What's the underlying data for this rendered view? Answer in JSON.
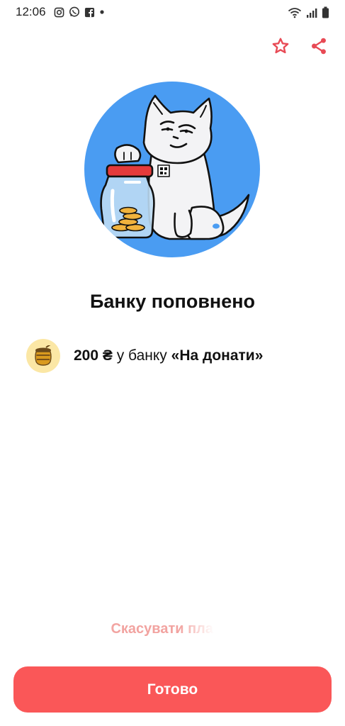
{
  "status_bar": {
    "time": "12:06",
    "left_icons": [
      "instagram-icon",
      "whatsapp-icon",
      "facebook-icon",
      "dot-icon"
    ],
    "right_icons": [
      "wifi-icon",
      "signal-icon",
      "battery-icon"
    ]
  },
  "header": {
    "actions": [
      "star-icon",
      "share-icon"
    ],
    "accent": "#e84a55"
  },
  "hero": {
    "circle_color": "#4a9cf2"
  },
  "title": "Банку поповнено",
  "bank": {
    "icon": "honey-jar-icon",
    "amount": "200 ₴",
    "middle": " у банку ",
    "name": "«На донати»"
  },
  "cancel_link": "Скасувати платіж",
  "done_button": "Готово",
  "colors": {
    "primary": "#fa5758",
    "cancel_text": "#f2a3a0",
    "avatar_bg": "#fbe7a5"
  }
}
